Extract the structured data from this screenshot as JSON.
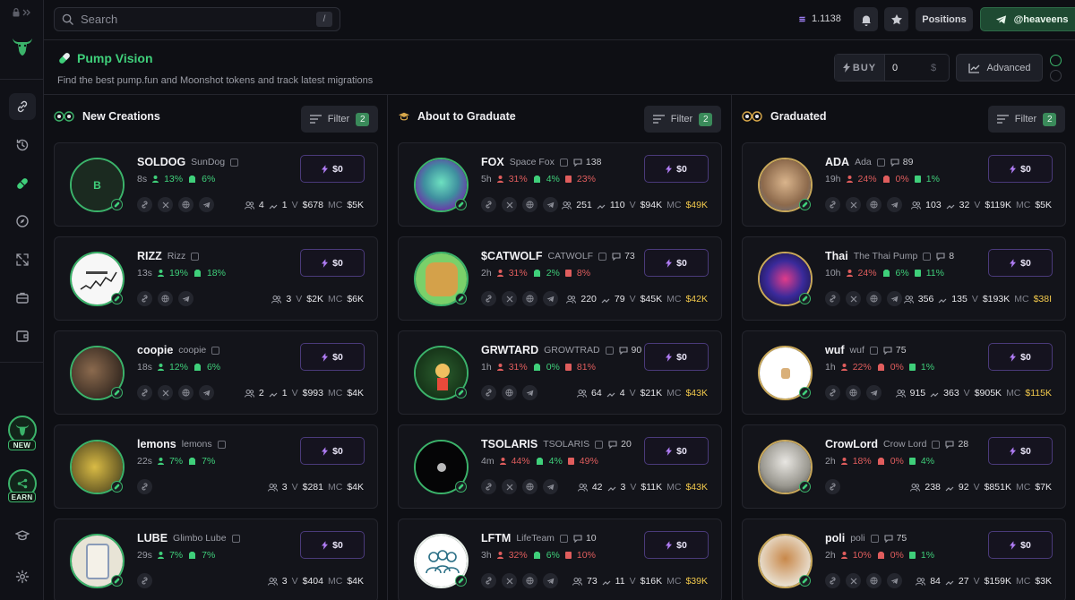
{
  "search": {
    "placeholder": "Search",
    "shortcut": "/"
  },
  "topbar": {
    "balance": "1.1138",
    "positions": "Positions",
    "telegram": "@heaveens"
  },
  "header": {
    "title": "Pump Vision",
    "subtitle": "Find the best pump.fun and Moonshot tokens and track latest migrations",
    "buy_label": "BUY",
    "buy_value": "0",
    "buy_currency": "$",
    "advanced": "Advanced"
  },
  "rail": {
    "new_badge": "NEW",
    "earn_badge": "EARN"
  },
  "columns": [
    {
      "title": "New Creations",
      "filter": "Filter",
      "filter_count": "2",
      "cards": [
        {
          "ticker": "SOLDOG",
          "name": "SunDog",
          "comments": "",
          "age": "8s",
          "holders": "13%",
          "dev": "6%",
          "sniper": "",
          "socials": 4,
          "holders_n": "4",
          "tx": "1",
          "vol": "$678",
          "mc": "$5K",
          "mc_gold": false,
          "avatar": "b",
          "buy": "$0"
        },
        {
          "ticker": "RIZZ",
          "name": "Rizz",
          "comments": "",
          "age": "13s",
          "holders": "19%",
          "dev": "18%",
          "sniper": "",
          "socials": 3,
          "holders_n": "3",
          "tx": "",
          "vol": "$2K",
          "mc": "$6K",
          "mc_gold": false,
          "avatar": "chart",
          "buy": "$0"
        },
        {
          "ticker": "coopie",
          "name": "coopie",
          "comments": "",
          "age": "18s",
          "holders": "12%",
          "dev": "6%",
          "sniper": "",
          "socials": 4,
          "holders_n": "2",
          "tx": "1",
          "vol": "$993",
          "mc": "$4K",
          "mc_gold": false,
          "avatar": "photo1",
          "buy": "$0"
        },
        {
          "ticker": "lemons",
          "name": "lemons",
          "comments": "",
          "age": "22s",
          "holders": "7%",
          "dev": "7%",
          "sniper": "",
          "socials": 1,
          "holders_n": "3",
          "tx": "",
          "vol": "$281",
          "mc": "$4K",
          "mc_gold": false,
          "avatar": "lemon",
          "buy": "$0"
        },
        {
          "ticker": "LUBE",
          "name": "Glimbo Lube",
          "comments": "",
          "age": "29s",
          "holders": "7%",
          "dev": "7%",
          "sniper": "",
          "socials": 1,
          "holders_n": "3",
          "tx": "",
          "vol": "$404",
          "mc": "$4K",
          "mc_gold": false,
          "avatar": "lube",
          "buy": "$0"
        }
      ]
    },
    {
      "title": "About to Graduate",
      "filter": "Filter",
      "filter_count": "2",
      "cards": [
        {
          "ticker": "FOX",
          "name": "Space Fox",
          "comments": "138",
          "age": "5h",
          "holders": "31%",
          "dev": "4%",
          "sniper": "23%",
          "socials": 4,
          "holders_n": "251",
          "tx": "110",
          "vol": "$94K",
          "mc": "$49K",
          "mc_gold": true,
          "avatar": "fox",
          "buy": "$0"
        },
        {
          "ticker": "$CATWOLF",
          "name": "CATWOLF",
          "comments": "73",
          "age": "2h",
          "holders": "31%",
          "dev": "2%",
          "sniper": "8%",
          "socials": 4,
          "holders_n": "220",
          "tx": "79",
          "vol": "$45K",
          "mc": "$42K",
          "mc_gold": true,
          "avatar": "cat",
          "buy": "$0"
        },
        {
          "ticker": "GRWTARD",
          "name": "GROWTRAD",
          "comments": "90",
          "age": "1h",
          "holders": "31%",
          "dev": "0%",
          "sniper": "81%",
          "socials": 3,
          "holders_n": "64",
          "tx": "4",
          "vol": "$21K",
          "mc": "$43K",
          "mc_gold": true,
          "avatar": "grw",
          "buy": "$0"
        },
        {
          "ticker": "TSOLARIS",
          "name": "TSOLARIS",
          "comments": "20",
          "age": "4m",
          "holders": "44%",
          "dev": "4%",
          "sniper": "49%",
          "socials": 4,
          "holders_n": "42",
          "tx": "3",
          "vol": "$11K",
          "mc": "$43K",
          "mc_gold": true,
          "avatar": "space",
          "buy": "$0"
        },
        {
          "ticker": "LFTM",
          "name": "LifeTeam",
          "comments": "10",
          "age": "3h",
          "holders": "32%",
          "dev": "6%",
          "sniper": "10%",
          "socials": 4,
          "holders_n": "73",
          "tx": "11",
          "vol": "$16K",
          "mc": "$39K",
          "mc_gold": true,
          "avatar": "team",
          "buy": "$0"
        }
      ]
    },
    {
      "title": "Graduated",
      "filter": "Filter",
      "filter_count": "2",
      "cards": [
        {
          "ticker": "ADA",
          "name": "Ada",
          "comments": "89",
          "age": "19h",
          "holders": "24%",
          "dev": "0%",
          "sniper": "1%",
          "socials": 4,
          "holders_n": "103",
          "tx": "32",
          "vol": "$119K",
          "mc": "$5K",
          "mc_gold": false,
          "avatar": "dog1",
          "buy": "$0"
        },
        {
          "ticker": "Thai",
          "name": "The Thai Pump",
          "comments": "8",
          "age": "10h",
          "holders": "24%",
          "dev": "6%",
          "sniper": "11%",
          "socials": 4,
          "holders_n": "356",
          "tx": "135",
          "vol": "$193K",
          "mc": "$38I",
          "mc_gold": true,
          "avatar": "thai",
          "buy": "$0"
        },
        {
          "ticker": "wuf",
          "name": "wuf",
          "comments": "75",
          "age": "1h",
          "holders": "22%",
          "dev": "0%",
          "sniper": "1%",
          "socials": 3,
          "holders_n": "915",
          "tx": "363",
          "vol": "$905K",
          "mc": "$115K",
          "mc_gold": true,
          "avatar": "wuf",
          "buy": "$0"
        },
        {
          "ticker": "CrowLord",
          "name": "Crow Lord",
          "comments": "28",
          "age": "2h",
          "holders": "18%",
          "dev": "0%",
          "sniper": "4%",
          "socials": 1,
          "holders_n": "238",
          "tx": "92",
          "vol": "$851K",
          "mc": "$7K",
          "mc_gold": false,
          "avatar": "crow",
          "buy": "$0"
        },
        {
          "ticker": "poli",
          "name": "poli",
          "comments": "75",
          "age": "2h",
          "holders": "10%",
          "dev": "0%",
          "sniper": "1%",
          "socials": 4,
          "holders_n": "84",
          "tx": "27",
          "vol": "$159K",
          "mc": "$3K",
          "mc_gold": false,
          "avatar": "dog2",
          "buy": "$0"
        }
      ]
    }
  ]
}
